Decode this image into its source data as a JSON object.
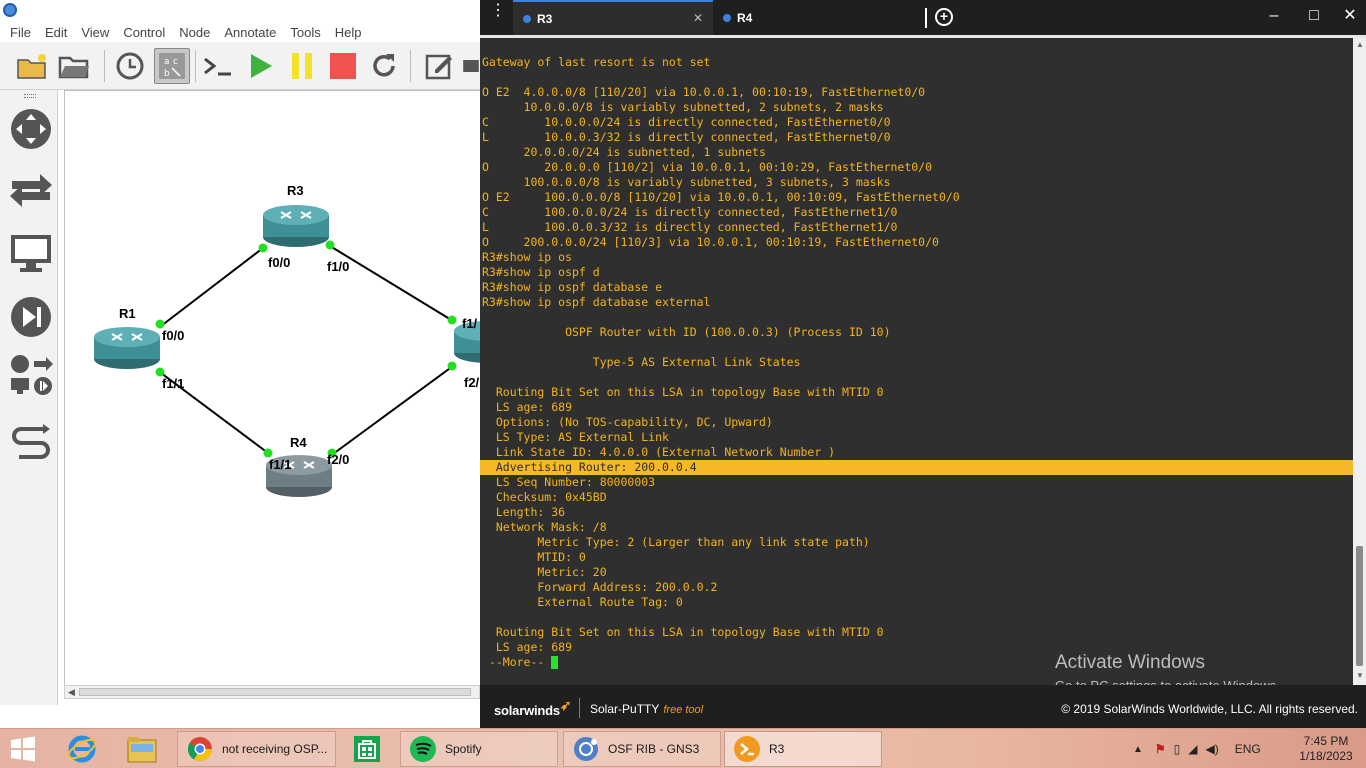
{
  "gns3": {
    "menu": [
      "File",
      "Edit",
      "View",
      "Control",
      "Node",
      "Annotate",
      "Tools",
      "Help"
    ],
    "nodes": {
      "r1": "R1",
      "r3": "R3",
      "r4": "R4"
    },
    "interfaces": {
      "r3_f00": "f0/0",
      "r3_f10": "f1/0",
      "r1_f00": "f0/0",
      "r1_f11": "f1/1",
      "r4_f11": "f1/1",
      "r4_f20": "f2/0",
      "r2_f1": "f1/",
      "r2_f2": "f2/"
    }
  },
  "putty": {
    "tabs": [
      {
        "label": "R3",
        "active": true
      },
      {
        "label": "R4",
        "active": false
      }
    ],
    "terminal_lines": [
      "Gateway of last resort is not set",
      "",
      "O E2  4.0.0.0/8 [110/20] via 10.0.0.1, 00:10:19, FastEthernet0/0",
      "      10.0.0.0/8 is variably subnetted, 2 subnets, 2 masks",
      "C        10.0.0.0/24 is directly connected, FastEthernet0/0",
      "L        10.0.0.3/32 is directly connected, FastEthernet0/0",
      "      20.0.0.0/24 is subnetted, 1 subnets",
      "O        20.0.0.0 [110/2] via 10.0.0.1, 00:10:29, FastEthernet0/0",
      "      100.0.0.0/8 is variably subnetted, 3 subnets, 3 masks",
      "O E2     100.0.0.0/8 [110/20] via 10.0.0.1, 00:10:09, FastEthernet0/0",
      "C        100.0.0.0/24 is directly connected, FastEthernet1/0",
      "L        100.0.0.3/32 is directly connected, FastEthernet1/0",
      "O     200.0.0.0/24 [110/3] via 10.0.0.1, 00:10:19, FastEthernet0/0",
      "R3#show ip os",
      "R3#show ip ospf d",
      "R3#show ip ospf database e",
      "R3#show ip ospf database external",
      "",
      "            OSPF Router with ID (100.0.0.3) (Process ID 10)",
      "",
      "                Type-5 AS External Link States",
      "",
      "  Routing Bit Set on this LSA in topology Base with MTID 0",
      "  LS age: 689",
      "  Options: (No TOS-capability, DC, Upward)",
      "  LS Type: AS External Link",
      "  Link State ID: 4.0.0.0 (External Network Number )",
      "  Advertising Router: 200.0.0.4",
      "  LS Seq Number: 80000003",
      "  Checksum: 0x45BD",
      "  Length: 36",
      "  Network Mask: /8",
      "        Metric Type: 2 (Larger than any link state path)",
      "        MTID: 0",
      "        Metric: 20",
      "        Forward Address: 200.0.0.2",
      "        External Route Tag: 0",
      "",
      "  Routing Bit Set on this LSA in topology Base with MTID 0",
      "  LS age: 689",
      " --More-- "
    ],
    "highlighted_line": "  Advertising Router: 200.0.0.4",
    "footer": {
      "brand": "solarwinds",
      "product": "Solar-PuTTY",
      "free_tool": "free tool",
      "copyright": "© 2019 SolarWinds Worldwide, LLC. All rights reserved."
    },
    "watermark": {
      "title": "Activate Windows",
      "subtitle": "Go to PC settings to activate Windows."
    }
  },
  "taskbar": {
    "tasks": [
      {
        "label": "not receiving OSP...",
        "icon": "chrome-icon"
      },
      {
        "label": "Spotify",
        "icon": "spotify-icon"
      },
      {
        "label": "OSF RIB - GNS3",
        "icon": "gns3-icon"
      },
      {
        "label": "R3",
        "icon": "solar-putty-icon"
      }
    ],
    "language": "ENG",
    "time": "7:45 PM",
    "date": "1/18/2023"
  },
  "colors": {
    "terminal_bg": "#2f2f2f",
    "terminal_text": "#f3b31d",
    "highlight": "#f5b928",
    "tab_accent": "#3c83dd",
    "link_up": "#20e020",
    "router_teal": "#3f8f96",
    "router_grey": "#6e7e86"
  }
}
